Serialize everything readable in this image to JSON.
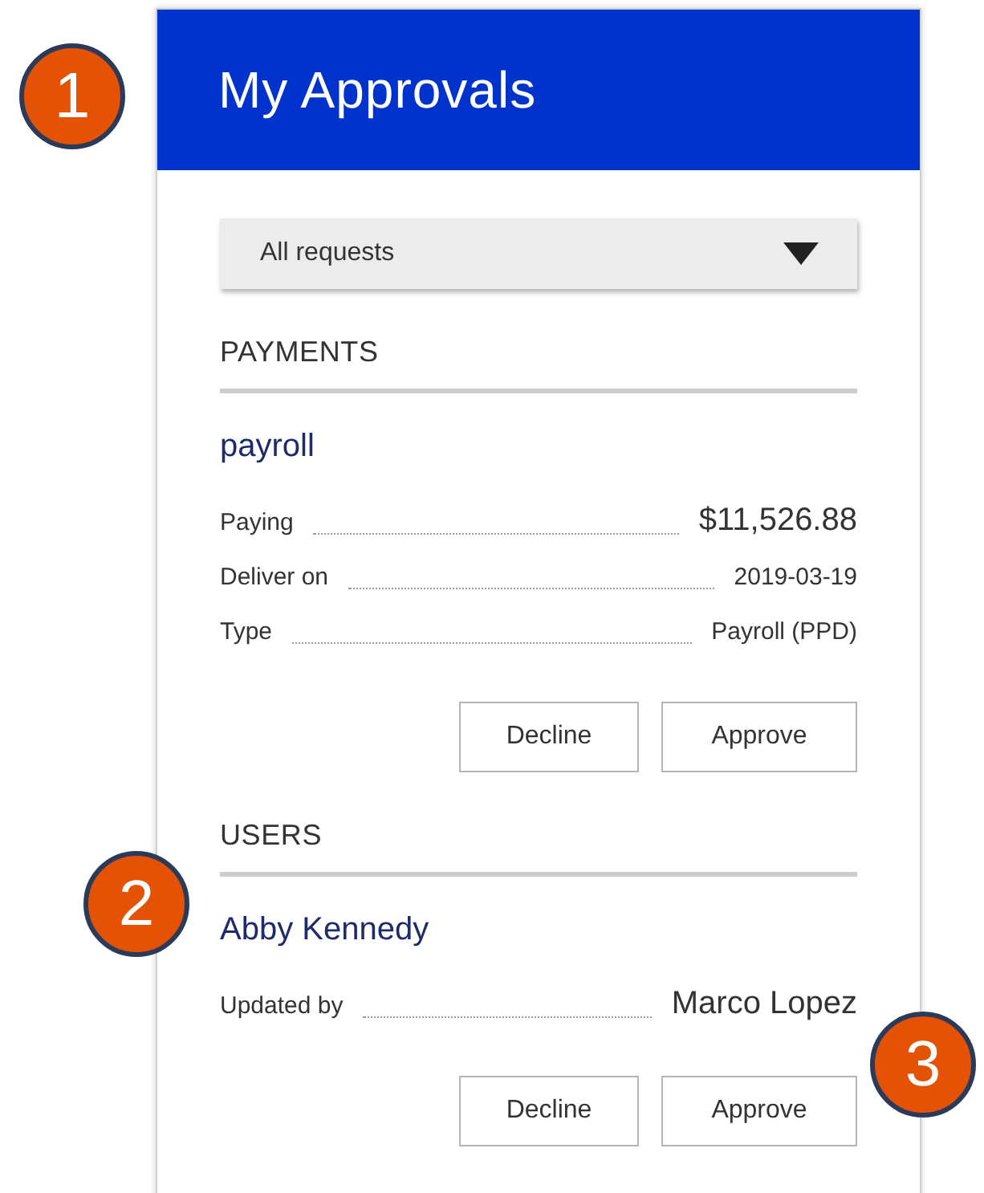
{
  "header": {
    "title": "My Approvals"
  },
  "filter": {
    "value": "All requests"
  },
  "sections": [
    {
      "heading": "PAYMENTS",
      "items": [
        {
          "title": "payroll",
          "fields": [
            {
              "kind": "large",
              "label": "Paying",
              "value": "$11,526.88"
            },
            {
              "kind": "small",
              "label": "Deliver on",
              "value": "2019-03-19"
            },
            {
              "kind": "small",
              "label": "Type",
              "value": "Payroll (PPD)"
            }
          ],
          "buttons": [
            "Decline",
            "Approve"
          ]
        }
      ]
    },
    {
      "heading": "USERS",
      "items": [
        {
          "title": "Abby Kennedy",
          "fields": [
            {
              "kind": "large",
              "label": "Updated by",
              "value": "Marco Lopez"
            }
          ],
          "buttons": [
            "Decline",
            "Approve"
          ]
        }
      ]
    }
  ],
  "callouts": [
    "1",
    "2",
    "3"
  ]
}
